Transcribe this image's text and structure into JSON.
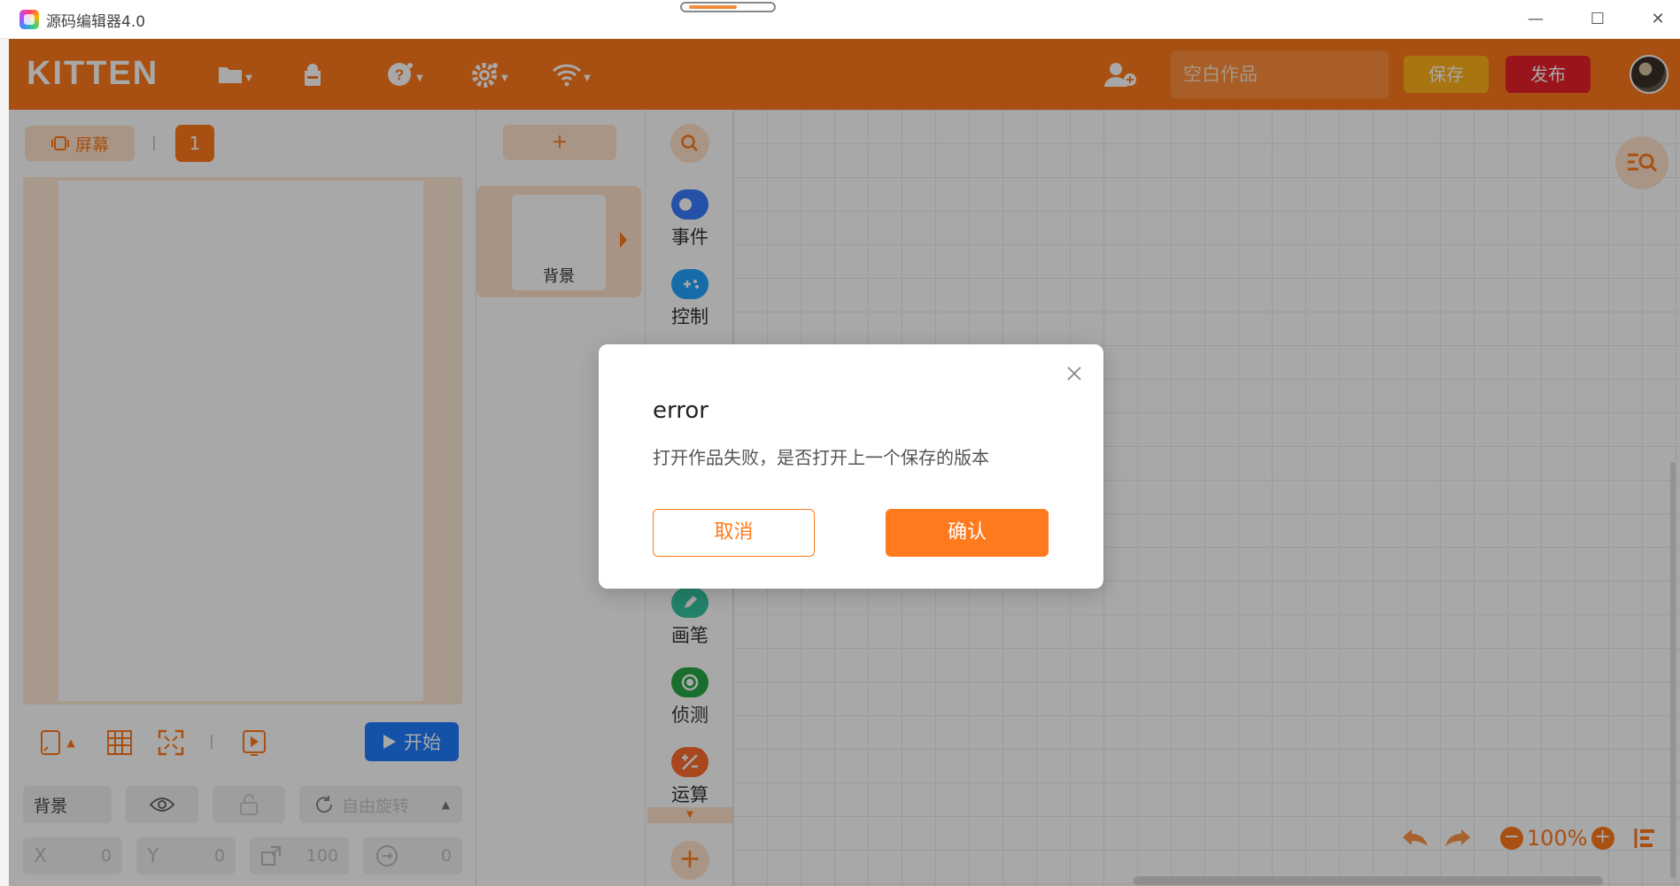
{
  "window": {
    "title": "源码编辑器4.0",
    "min_glyph": "—",
    "max_glyph": "☐",
    "close_glyph": "✕"
  },
  "header": {
    "logo": "KITTEN",
    "project_placeholder": "空白作品",
    "save_label": "保存",
    "publish_label": "发布",
    "icons": [
      "folder-icon",
      "bag-icon",
      "help-icon",
      "gear-icon",
      "wifi-icon",
      "add-user-icon"
    ],
    "accent_color": "#ff7a1c"
  },
  "stage_panel": {
    "screen_label": "屏幕",
    "page_number": "1",
    "start_label": "开始",
    "props": {
      "name": "背景",
      "rotation": "自由旋转",
      "x_label": "X",
      "x": "0",
      "y_label": "Y",
      "y": "0",
      "size": "100",
      "direction": "0"
    }
  },
  "sprite_panel": {
    "add_label": "+",
    "background_label": "背景"
  },
  "categories": [
    {
      "label": "事件",
      "color": "#3a7bff"
    },
    {
      "label": "控制",
      "color": "#20a4ff"
    },
    {
      "label": "画笔",
      "color": "#34c6a2"
    },
    {
      "label": "侦测",
      "color": "#28a745"
    },
    {
      "label": "运算",
      "color": "#ff6b2c"
    }
  ],
  "workspace": {
    "zoom": "100%"
  },
  "dialog": {
    "title": "error",
    "message": "打开作品失败，是否打开上一个保存的版本",
    "cancel_label": "取消",
    "confirm_label": "确认"
  }
}
